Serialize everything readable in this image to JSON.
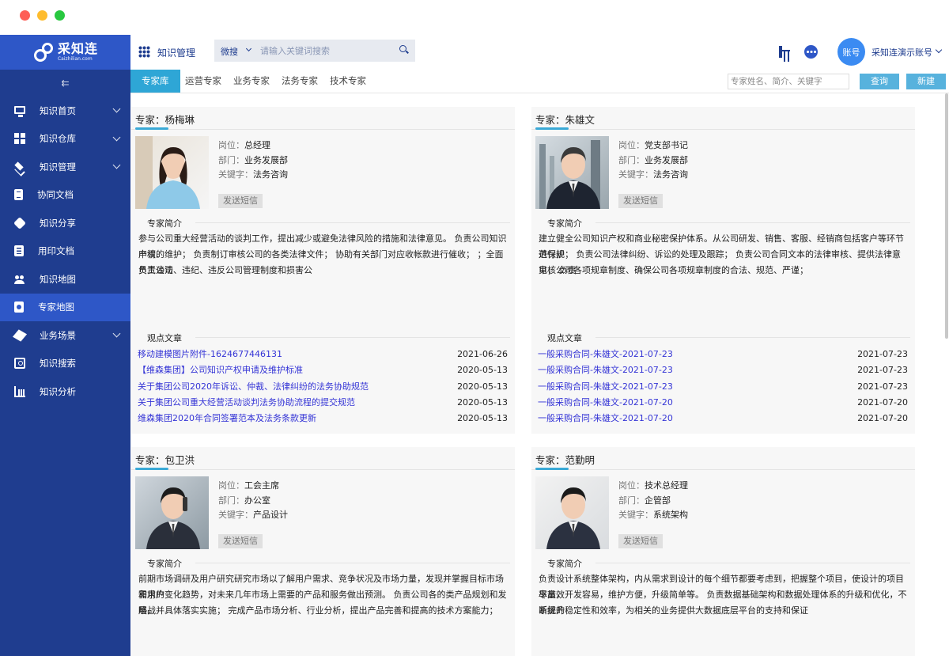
{
  "sidebar": {
    "logo_main": "采知连",
    "logo_sub": "Caizhilian.com",
    "items": [
      {
        "label": "知识首页",
        "icon": "monitor-icon",
        "has_children": true
      },
      {
        "label": "知识仓库",
        "icon": "grid-icon",
        "has_children": true
      },
      {
        "label": "知识管理",
        "icon": "layers-icon",
        "has_children": true
      },
      {
        "label": "协同文档",
        "icon": "document-icon",
        "has_children": false
      },
      {
        "label": "知识分享",
        "icon": "share-icon",
        "has_children": false
      },
      {
        "label": "用印文档",
        "icon": "list-icon",
        "has_children": false
      },
      {
        "label": "知识地图",
        "icon": "users-icon",
        "has_children": false
      },
      {
        "label": "专家地图",
        "icon": "expert-icon",
        "has_children": false,
        "active": true
      },
      {
        "label": "业务场景",
        "icon": "cube-icon",
        "has_children": true
      },
      {
        "label": "知识搜索",
        "icon": "search-box-icon",
        "has_children": false
      },
      {
        "label": "知识分析",
        "icon": "bar-chart-icon",
        "has_children": false
      }
    ]
  },
  "header": {
    "title": "知识管理",
    "search_scope": "微搜",
    "search_placeholder": "请输入关键词搜索",
    "avatar_label": "账号",
    "account_name": "采知连演示账号"
  },
  "tabs": [
    "专家库",
    "运营专家",
    "业务专家",
    "法务专家",
    "技术专家"
  ],
  "filter": {
    "placeholder": "专家姓名、简介、关键字",
    "query_label": "查询",
    "new_label": "新建"
  },
  "labels": {
    "position": "岗位：",
    "department": "部门：",
    "keyword": "关键字：",
    "sms": "发送短信",
    "intro": "专家简介",
    "articles": "观点文章"
  },
  "experts": [
    {
      "header": "专家：杨梅琳",
      "position": "总经理",
      "department": "业务发展部",
      "keyword": "法务咨询",
      "bio": [
        "参与公司重大经营活动的谈判工作，提出减少或避免法律风险的措施和法律意见。 负责公司知识产权的",
        "申请、维护； 负责制订审核公司的各类法律文件； 协助有关部门对应收帐款进行催收； ；全面负责公司",
        "员工违法、违纪、违反公司管理制度和损害公"
      ],
      "articles": [
        {
          "title": "移动建模图片附件-1624677446131",
          "date": "2021-06-26"
        },
        {
          "title": "【维森集团】公司知识产权申请及维护标准",
          "date": "2020-05-13"
        },
        {
          "title": "关于集团公司2020年诉讼、仲裁、法律纠纷的法务协助规范",
          "date": "2020-05-13"
        },
        {
          "title": "关于集团公司重大经营活动谈判法务协助流程的提交规范",
          "date": "2020-05-13"
        },
        {
          "title": "维森集团2020年合同签署范本及法务条款更新",
          "date": "2020-05-13"
        }
      ]
    },
    {
      "header": "专家：朱雄文",
      "position": "党支部书记",
      "department": "业务发展部",
      "keyword": "法务咨询",
      "bio": [
        "建立健全公司知识产权和商业秘密保护体系。从公司研发、销售、客服、经销商包括客户等环节进行规",
        "范保护； 负责公司法律纠纷、诉讼的处理及跟踪； 负责公司合同文本的法律审核、提供法律意见； 负责",
        "审核公司各项规章制度、确保公司各项规章制度的合法、规范、严谨；"
      ],
      "articles": [
        {
          "title": "一般采购合同-朱雄文-2021-07-23",
          "date": "2021-07-23"
        },
        {
          "title": "一般采购合同-朱雄文-2021-07-23",
          "date": "2021-07-23"
        },
        {
          "title": "一般采购合同-朱雄文-2021-07-23",
          "date": "2021-07-23"
        },
        {
          "title": "一般采购合同-朱雄文-2021-07-20",
          "date": "2021-07-20"
        },
        {
          "title": "一般采购合同-朱雄文-2021-07-20",
          "date": "2021-07-20"
        }
      ]
    },
    {
      "header": "专家：包卫洪",
      "position": "工会主席",
      "department": "办公室",
      "keyword": "产品设计",
      "bio": [
        "前期市场调研及用户研究研究市场以了解用户需求、竞争状况及市场力量，发现并掌握目标市场和用户",
        "需求的变化趋势，对未来几年市场上需要的产品和服务做出预测。 负责公司各的类产品规划和发展战",
        "略，并具体落实实施； 完成产品市场分析、行业分析，提出产品完善和提高的技术方案能力；"
      ],
      "articles": []
    },
    {
      "header": "专家：范勤明",
      "position": "技术总经理",
      "department": "企管部",
      "keyword": "系统架构",
      "bio": [
        "负责设计系统整体架构，内从需求到设计的每个细节都要考虑到，把握整个项目，使设计的项目尽量效",
        "率高，开发容易，维护方便，升级简单等。 负责数据基础架构和数据处理体系的升级和优化，不断提升",
        "系统的稳定性和效率，为相关的业务提供大数据底层平台的支持和保证"
      ],
      "articles": []
    }
  ],
  "colors": {
    "sidebar_bg": "#1f3d8f",
    "sidebar_active": "#2e57c7",
    "tab_active": "#2ea6d6",
    "link": "#3535d6"
  }
}
